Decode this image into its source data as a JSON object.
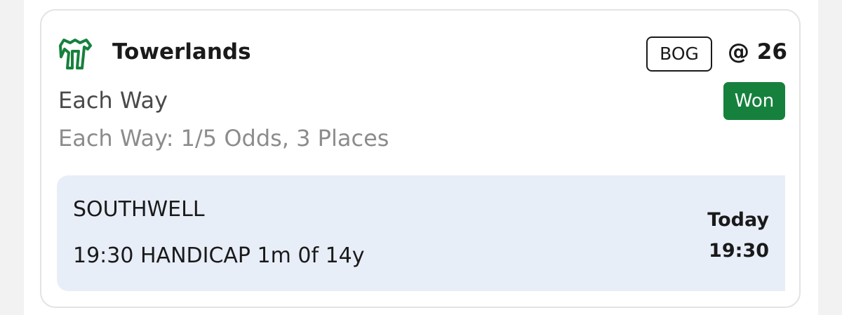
{
  "selection": {
    "runner_name": "Towerlands",
    "bog_label": "BOG",
    "odds": "@ 26",
    "bet_type": "Each Way",
    "result": "Won",
    "each_way_terms": "Each Way: 1/5 Odds, 3 Places",
    "icon": "horse-racing-icon"
  },
  "event": {
    "venue": "SOUTHWELL",
    "race": "19:30 HANDICAP 1m 0f 14y",
    "day": "Today",
    "time": "19:30"
  },
  "colors": {
    "brand_green": "#16813d",
    "won_badge": "#16813d",
    "event_panel_bg": "#e8eef8"
  }
}
